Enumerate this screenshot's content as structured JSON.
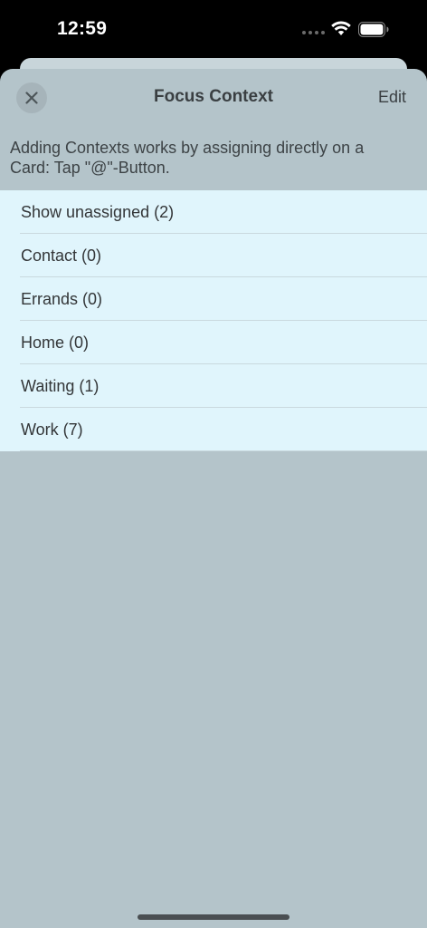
{
  "status_bar": {
    "time": "12:59",
    "icons": [
      "signal-dots-icon",
      "wifi-icon",
      "battery-icon"
    ]
  },
  "header": {
    "title": "Focus Context",
    "close_icon": "close-icon",
    "edit_label": "Edit"
  },
  "info": {
    "text": "Adding Contexts works by assigning directly on a Card: Tap \"@\"-Button."
  },
  "contexts": {
    "items": [
      {
        "label": "Show unassigned (2)"
      },
      {
        "label": "Contact (0)"
      },
      {
        "label": "Errands (0)"
      },
      {
        "label": "Home (0)"
      },
      {
        "label": "Waiting (1)"
      },
      {
        "label": "Work (7)"
      }
    ]
  },
  "colors": {
    "sheet_background": "#b4c4ca",
    "list_background": "#e0f5fc",
    "status_bar_background": "#000000"
  }
}
